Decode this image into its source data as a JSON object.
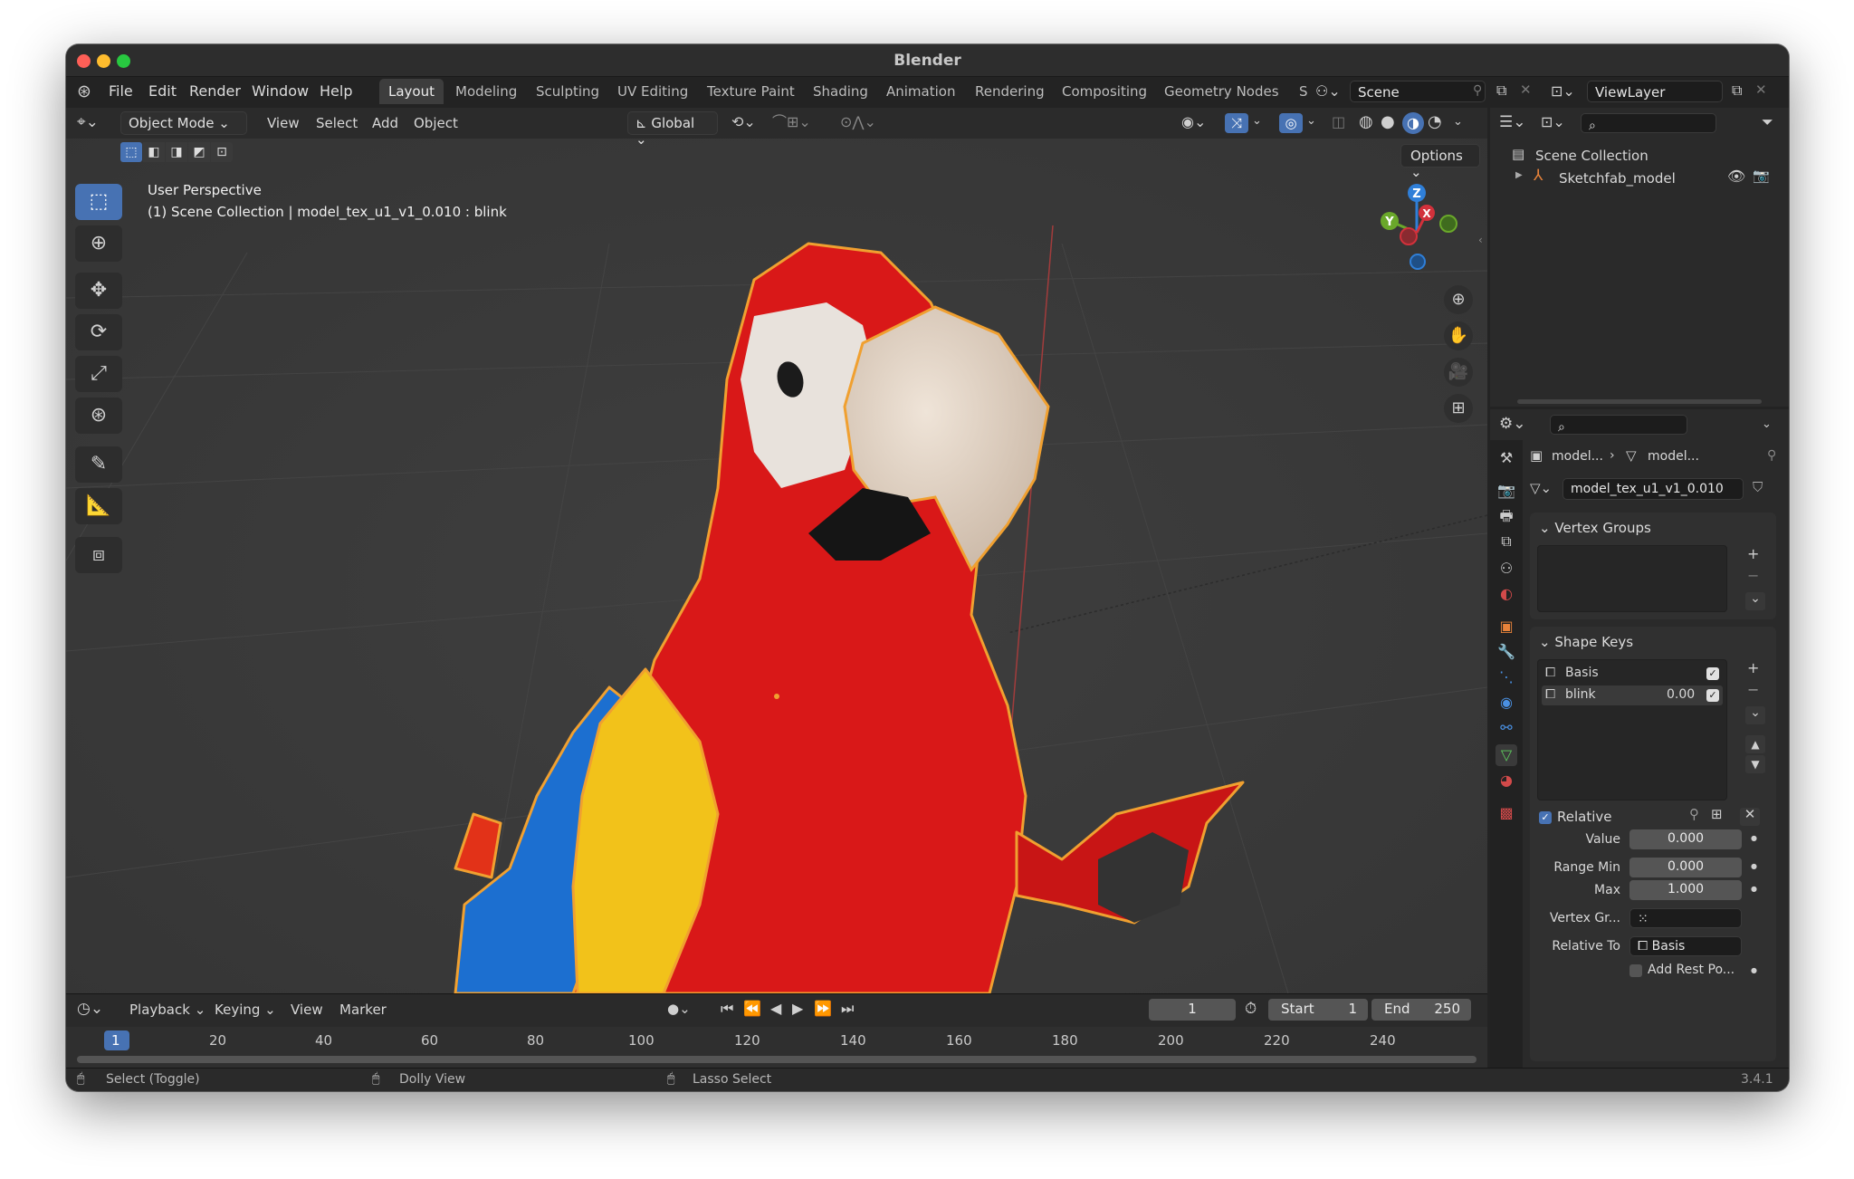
{
  "window": {
    "title": "Blender",
    "version": "3.4.1"
  },
  "menu": [
    "File",
    "Edit",
    "Render",
    "Window",
    "Help"
  ],
  "workspaces": [
    "Layout",
    "Modeling",
    "Sculpting",
    "UV Editing",
    "Texture Paint",
    "Shading",
    "Animation",
    "Rendering",
    "Compositing",
    "Geometry Nodes",
    "S"
  ],
  "scene": {
    "name": "Scene",
    "view_layer": "ViewLayer"
  },
  "viewport": {
    "mode": "Object Mode",
    "menus": [
      "View",
      "Select",
      "Add",
      "Object"
    ],
    "orientation": "Global",
    "options_label": "Options",
    "overlay_line1": "User Perspective",
    "overlay_line2": "(1) Scene Collection | model_tex_u1_v1_0.010 : blink",
    "gizmo_axes": {
      "z": "Z",
      "y": "Y",
      "x": "X"
    }
  },
  "outliner": {
    "root": "Scene Collection",
    "items": [
      {
        "label": "Sketchfab_model"
      }
    ]
  },
  "properties": {
    "breadcrumb": [
      "model...",
      "model..."
    ],
    "mesh_name": "model_tex_u1_v1_0.010",
    "vertex_groups": {
      "title": "Vertex Groups"
    },
    "shape_keys": {
      "title": "Shape Keys",
      "keys": [
        {
          "name": "Basis",
          "value": ""
        },
        {
          "name": "blink",
          "value": "0.00"
        }
      ],
      "relative_label": "Relative",
      "value_label": "Value",
      "value": "0.000",
      "range_min_label": "Range Min",
      "range_min": "0.000",
      "max_label": "Max",
      "max": "1.000",
      "vertex_group_label": "Vertex Gr...",
      "relative_to_label": "Relative To",
      "relative_to": "Basis",
      "add_rest_label": "Add Rest Po..."
    }
  },
  "timeline": {
    "menus": [
      "Playback",
      "Keying",
      "View",
      "Marker"
    ],
    "current_frame": "1",
    "start_label": "Start",
    "start": "1",
    "end_label": "End",
    "end": "250",
    "ticks": [
      "1",
      "20",
      "40",
      "60",
      "80",
      "100",
      "120",
      "140",
      "160",
      "180",
      "200",
      "220",
      "240"
    ]
  },
  "statusbar": {
    "hints": [
      "Select (Toggle)",
      "Dolly View",
      "Lasso Select"
    ]
  },
  "colors": {
    "accent": "#4772b3",
    "selection_outline": "#f0a030",
    "parrot_red": "#d91818",
    "parrot_yellow": "#f2c21a",
    "parrot_blue": "#1c6fd0"
  }
}
